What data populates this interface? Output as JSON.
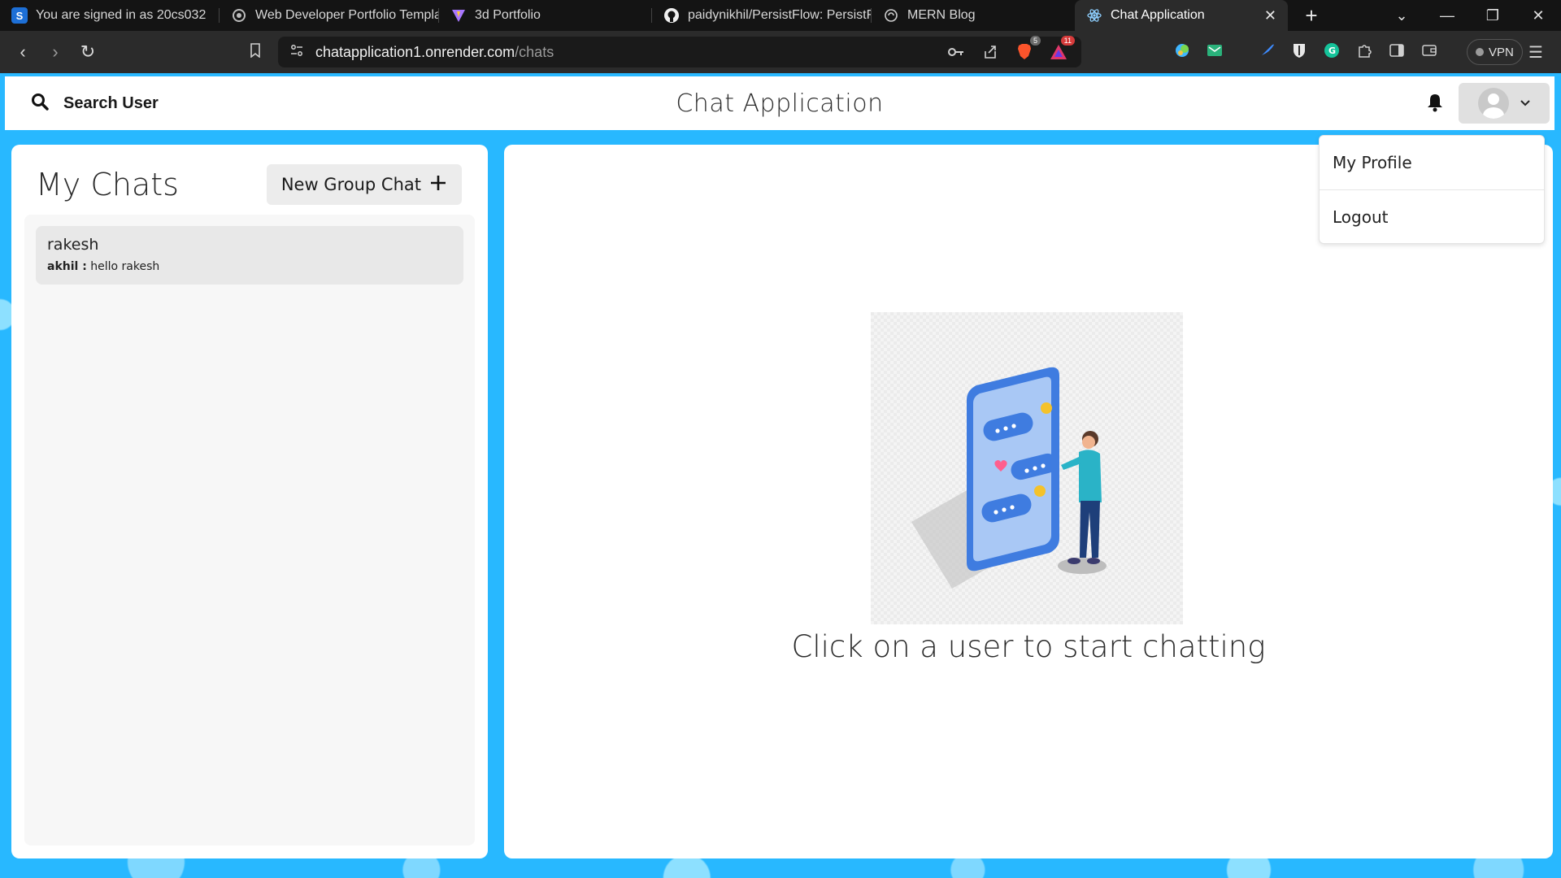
{
  "browser": {
    "tabs": [
      {
        "title": "You are signed in as 20cs032",
        "icon": "s-logo-icon",
        "active": false
      },
      {
        "title": "Web Developer Portfolio Templat",
        "icon": "openai-icon",
        "active": false
      },
      {
        "title": "3d Portfolio",
        "icon": "vite-icon",
        "active": false
      },
      {
        "title": "paidynikhil/PersistFlow: PersistFlo",
        "icon": "github-icon",
        "active": false
      },
      {
        "title": "MERN Blog",
        "icon": "globe-icon",
        "active": false
      },
      {
        "title": "Chat Application",
        "icon": "react-icon",
        "active": true
      }
    ],
    "url_host": "chatapplication1.onrender.com",
    "url_path": "/chats",
    "badges": {
      "brave": "5",
      "rewards": "11"
    },
    "vpn_label": "VPN"
  },
  "header": {
    "search_label": "Search User",
    "title": "Chat Application"
  },
  "profile_menu": {
    "items": [
      "My Profile",
      "Logout"
    ]
  },
  "sidebar": {
    "title": "My Chats",
    "new_group_label": "New Group Chat",
    "chats": [
      {
        "name": "rakesh",
        "sender": "akhil :",
        "message": "hello rakesh"
      }
    ]
  },
  "main": {
    "empty_text": "Click on a user to start chatting"
  },
  "colors": {
    "page_background": "#28b8ff",
    "panel": "#ffffff",
    "chat_item": "#e8e8e8"
  }
}
